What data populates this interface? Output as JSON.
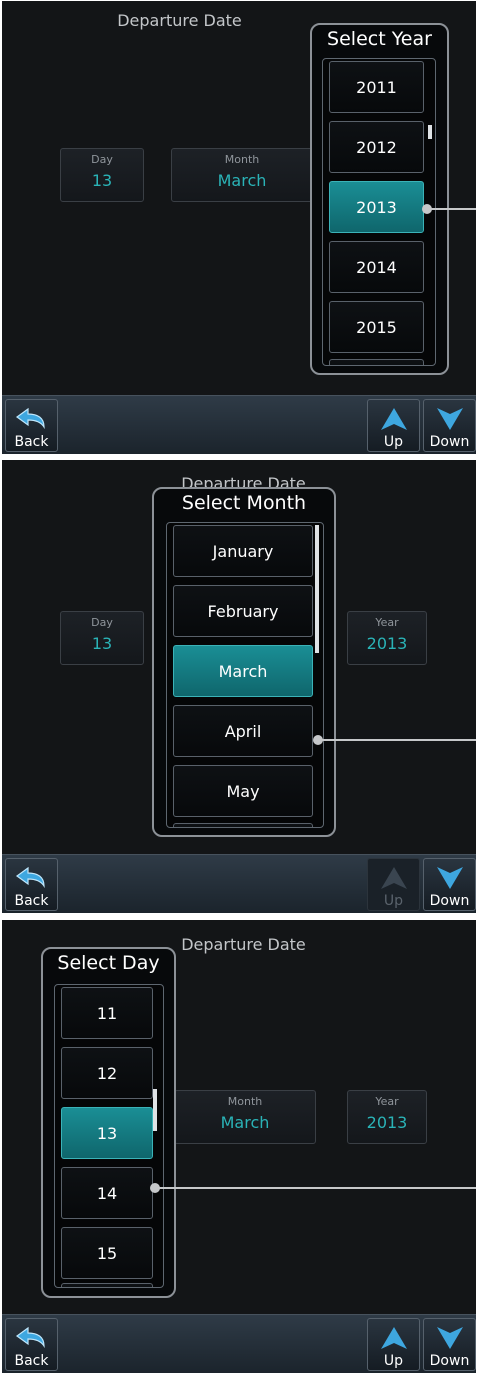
{
  "colors": {
    "accent": "#2ab3b7",
    "selected": "#1a8e95",
    "icon_blue": "#3ea7e0"
  },
  "screens": [
    {
      "title": "Departure Date",
      "fields": {
        "day": {
          "label": "Day",
          "value": "13"
        },
        "month": {
          "label": "Month",
          "value": "March"
        }
      },
      "popup": {
        "title": "Select Year",
        "options": [
          "2011",
          "2012",
          "2013",
          "2014",
          "2015"
        ],
        "selected": "2013"
      },
      "buttons": {
        "back": "Back",
        "up": "Up",
        "down": "Down",
        "up_enabled": true,
        "down_enabled": true
      }
    },
    {
      "title": "Departure Date",
      "fields": {
        "day": {
          "label": "Day",
          "value": "13"
        },
        "year": {
          "label": "Year",
          "value": "2013"
        }
      },
      "popup": {
        "title": "Select Month",
        "options": [
          "January",
          "February",
          "March",
          "April",
          "May"
        ],
        "selected": "March"
      },
      "buttons": {
        "back": "Back",
        "up": "Up",
        "down": "Down",
        "up_enabled": false,
        "down_enabled": true
      }
    },
    {
      "title": "Departure Date",
      "fields": {
        "month": {
          "label": "Month",
          "value": "March"
        },
        "year": {
          "label": "Year",
          "value": "2013"
        }
      },
      "popup": {
        "title": "Select Day",
        "options": [
          "11",
          "12",
          "13",
          "14",
          "15"
        ],
        "selected": "13"
      },
      "buttons": {
        "back": "Back",
        "up": "Up",
        "down": "Down",
        "up_enabled": true,
        "down_enabled": true
      }
    }
  ]
}
